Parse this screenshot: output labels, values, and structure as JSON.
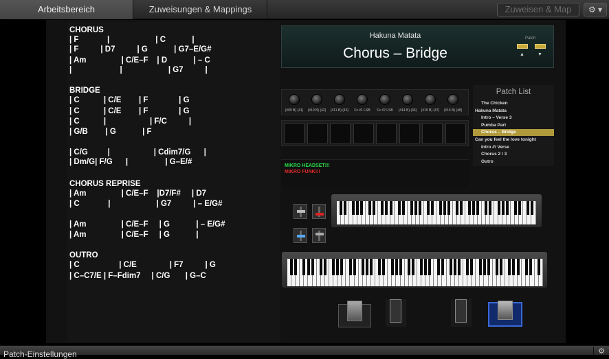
{
  "topbar": {
    "tabs": [
      {
        "label": "Arbeitsbereich"
      },
      {
        "label": "Zuweisungen & Mappings"
      }
    ],
    "assign_button": "Zuweisen & Map",
    "gear_icon": "gear-icon"
  },
  "chord_sheet": [
    {
      "text": "CHORUS"
    },
    {
      "text": "| F             |                     | C            |"
    },
    {
      "text": "| F          | D7          | G            | G7–E/G#"
    },
    {
      "text": "| Am                | C/E–F    | D            | – C"
    },
    {
      "text": "|                      |                     | G7          |"
    },
    {
      "text": ""
    },
    {
      "text": "BRIDGE"
    },
    {
      "text": "| C           | C/E        | F              | G"
    },
    {
      "text": "| C           | C/E        | F              | G"
    },
    {
      "text": "| C           |                    | F/C          |"
    },
    {
      "text": "| G/B        | G            | F"
    },
    {
      "text": ""
    },
    {
      "text": "| C/G         |                    | Cdim7/G      |"
    },
    {
      "text": "| Dm/G| F/G      |                 | G–E/#"
    },
    {
      "text": ""
    },
    {
      "text": "CHORUS REPRISE"
    },
    {
      "text": "| Am                | C/E–F    |D7/F#     | D7"
    },
    {
      "text": "| C             |                     | G7          | – E/G#"
    },
    {
      "text": ""
    },
    {
      "text": "| Am                | C/E–F     | G            | – E/G#"
    },
    {
      "text": "| Am                | C/E–F     | G            |"
    },
    {
      "text": ""
    },
    {
      "text": "OUTRO"
    },
    {
      "text": "| C                  | C/E               | F7          | G"
    },
    {
      "text": "| C–C7/E | F–Fdim7     | C/G       | G–C"
    }
  ],
  "display": {
    "song": "Hakuna Matata",
    "patch": "Chorus – Bridge",
    "patch_label": "Patch"
  },
  "knobs": [
    {
      "label": "(#09 B) (41)"
    },
    {
      "label": "(#10 B) (42)"
    },
    {
      "label": "(#11 B) (43)"
    },
    {
      "label": "Fx #1 LSB"
    },
    {
      "label": "Fx #2 LSB"
    },
    {
      "label": "(#14 B) (46)"
    },
    {
      "label": "(#15 B) (47)"
    },
    {
      "label": "(#16 B) (48)"
    }
  ],
  "patch_list": {
    "title": "Patch List",
    "items": [
      {
        "label": "The Chicken",
        "indent": true,
        "selected": false
      },
      {
        "label": "Hakuna Matata",
        "indent": false,
        "selected": false
      },
      {
        "label": "Intro – Verse 3",
        "indent": true,
        "selected": false
      },
      {
        "label": "Pumba Part",
        "indent": true,
        "selected": false
      },
      {
        "label": "Chorus – Bridge",
        "indent": true,
        "selected": true
      },
      {
        "label": "Can you feel the love tonight",
        "indent": false,
        "selected": false
      },
      {
        "label": "Intro /// Verse",
        "indent": true,
        "selected": false
      },
      {
        "label": "Chorus 2 / 3",
        "indent": true,
        "selected": false
      },
      {
        "label": "Outro",
        "indent": true,
        "selected": false
      }
    ]
  },
  "status": {
    "line1": "MIKRO HEADSET!!!",
    "line2": "MIKRO FUNK!!!",
    "line1_color": "#29e04a",
    "line2_color": "#e02a2a"
  },
  "bottombar": {
    "label": "Patch-Einstellungen"
  },
  "colors": {
    "selected": "#b09a3c",
    "display_bg": "#1c302e"
  }
}
